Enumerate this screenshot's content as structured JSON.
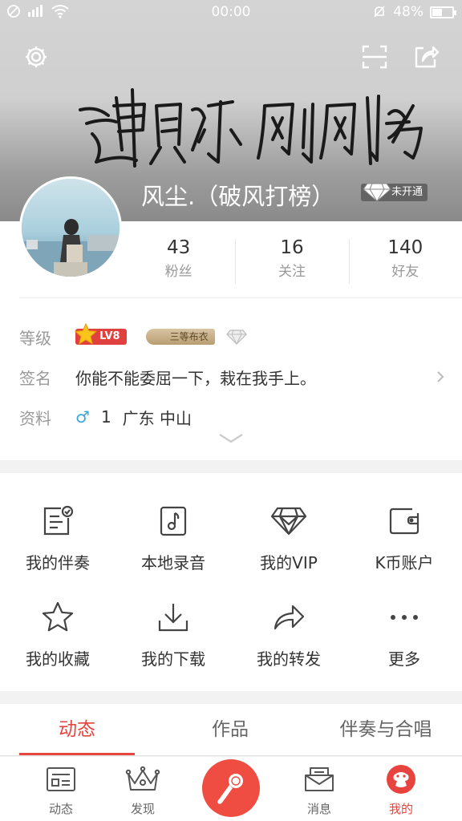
{
  "status_bar": {
    "time": "00:00",
    "battery": "48%",
    "battery_level": 0.48
  },
  "header": {
    "settings_icon": "gear-icon",
    "scan_icon": "scan-icon",
    "share_icon": "share-icon",
    "username": "风尘.（破风打榜）",
    "vip_status": "未开通"
  },
  "stats": [
    {
      "value": "43",
      "label": "粉丝"
    },
    {
      "value": "16",
      "label": "关注"
    },
    {
      "value": "140",
      "label": "好友"
    }
  ],
  "info": {
    "level_key": "等级",
    "level_badge": "LV8",
    "cloth_badge": "三等布衣",
    "signature_key": "签名",
    "signature": "你能不能委屈一下，栽在我手上。",
    "profile_key": "资料",
    "gender_symbol": "♂",
    "age": "1",
    "location": "广东 中山"
  },
  "menu": [
    {
      "label": "我的伴奏",
      "icon": "accompaniment-icon"
    },
    {
      "label": "本地录音",
      "icon": "local-recording-icon"
    },
    {
      "label": "我的VIP",
      "icon": "vip-diamond-icon"
    },
    {
      "label": "K币账户",
      "icon": "wallet-icon"
    },
    {
      "label": "我的收藏",
      "icon": "star-icon"
    },
    {
      "label": "我的下载",
      "icon": "download-icon"
    },
    {
      "label": "我的转发",
      "icon": "forward-icon"
    },
    {
      "label": "更多",
      "icon": "more-icon"
    }
  ],
  "tabs": [
    {
      "label": "动态",
      "active": true
    },
    {
      "label": "作品",
      "active": false
    },
    {
      "label": "伴奏与合唱",
      "active": false
    }
  ],
  "bottom_nav": [
    {
      "label": "动态",
      "icon": "feed-icon"
    },
    {
      "label": "发现",
      "icon": "crown-icon"
    },
    {
      "label": "",
      "icon": "microphone-icon"
    },
    {
      "label": "消息",
      "icon": "mail-icon"
    },
    {
      "label": "我的",
      "icon": "profile-icon"
    }
  ],
  "colors": {
    "accent": "#e8443f",
    "vip_gold": "#f5b800"
  }
}
